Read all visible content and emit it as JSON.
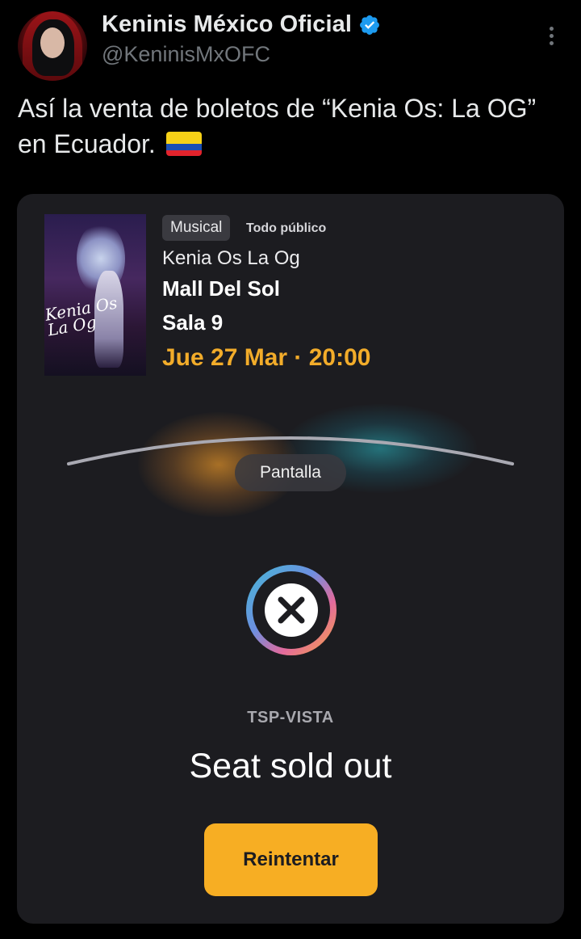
{
  "tweet": {
    "author": {
      "display_name": "Keninis México Oficial",
      "handle": "@KeninisMxOFC",
      "verified": true,
      "avatar_icon": "avatar-photo"
    },
    "text": "Así la venta de boletos de “Kenia Os: La OG” en Ecuador.",
    "emoji": "flag-ecuador-icon"
  },
  "ticket_screen": {
    "poster_text": "Kenia Os La Og",
    "genre_tag": "Musical",
    "rating": "Todo público",
    "movie_title": "Kenia Os La Og",
    "cinema": "Mall Del Sol",
    "room": "Sala 9",
    "showtime": "Jue 27 Mar · 20:00",
    "screen_label": "Pantalla",
    "provider": "TSP-VISTA",
    "status_message": "Seat sold out",
    "retry_label": "Reintentar"
  },
  "colors": {
    "background": "#000000",
    "card": "#1c1c20",
    "accent": "#f7ae23",
    "showtime": "#f2ac2a",
    "verified": "#1d9bf0",
    "muted": "#71767b"
  }
}
